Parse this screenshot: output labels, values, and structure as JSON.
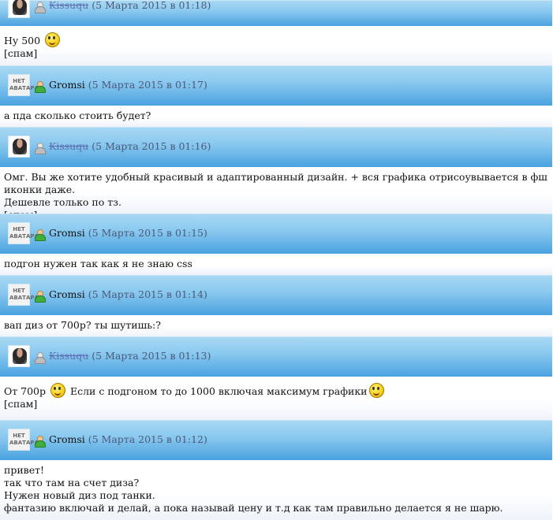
{
  "posts": [
    {
      "author": "Kissuqu",
      "banned": true,
      "avatar": "photo",
      "timestamp": "(5 Марта 2015 в 01:18)",
      "lines": [
        {
          "text": "Ну 500",
          "smiley": true
        },
        {
          "text": "[спам]"
        }
      ]
    },
    {
      "author": "Gromsi",
      "banned": false,
      "avatar": "none",
      "timestamp": "(5 Марта 2015 в 01:17)",
      "lines": [
        {
          "text": "а пда сколько стоить будет?"
        }
      ]
    },
    {
      "author": "Kissuqu",
      "banned": true,
      "avatar": "photo",
      "timestamp": "(5 Марта 2015 в 01:16)",
      "lines": [
        {
          "text": "Омг. Вы же хотите удобный красивый и адаптированный дизайн. + вся графика отрисоувывается в фш иконки даже."
        },
        {
          "text": "Дешевле только по тз."
        },
        {
          "text": "[спам]"
        }
      ]
    },
    {
      "author": "Gromsi",
      "banned": false,
      "avatar": "none",
      "timestamp": "(5 Марта 2015 в 01:15)",
      "lines": [
        {
          "text": "подгон нужен так как я не знаю css"
        }
      ]
    },
    {
      "author": "Gromsi",
      "banned": false,
      "avatar": "none",
      "timestamp": "(5 Марта 2015 в 01:14)",
      "lines": [
        {
          "text": "вап диз от 700р? ты шутишь:?"
        }
      ]
    },
    {
      "author": "Kissuqu",
      "banned": true,
      "avatar": "photo",
      "timestamp": "(5 Марта 2015 в 01:13)",
      "lines": [
        {
          "text": "От 700р",
          "smiley": true,
          "text2": "Если с подгоном то до 1000 включая максимум графики",
          "smiley2": true
        },
        {
          "text": "[спам]"
        }
      ]
    },
    {
      "author": "Gromsi",
      "banned": false,
      "avatar": "none",
      "timestamp": "(5 Марта 2015 в 01:12)",
      "lines": [
        {
          "text": "привет!"
        },
        {
          "text": "так что там на счет диза?"
        },
        {
          "text": "Нужен новый диз под танки."
        },
        {
          "text": "фантазию включай и делай, а пока называй цену и т.д как там правильно делается я не шарю."
        }
      ]
    }
  ],
  "no_avatar_text": [
    "НЕТ",
    "АВАТАРА"
  ],
  "icons": {
    "user_online": "user-online-icon",
    "user_banned": "user-banned-icon",
    "smiley": "smiley-icon"
  }
}
